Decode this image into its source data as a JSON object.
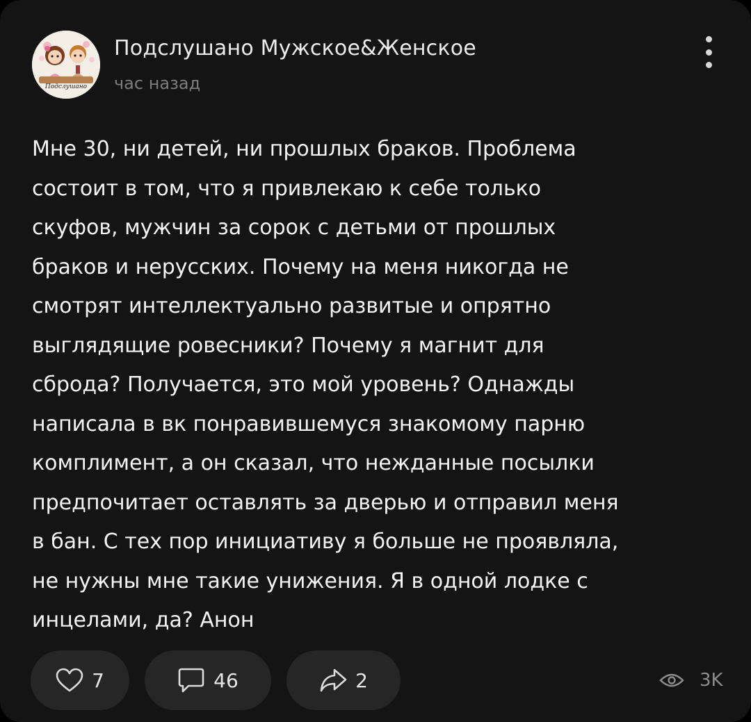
{
  "post": {
    "channel_name": "Подслушано Мужское&Женское",
    "time": "час назад",
    "avatar_caption": "Подслушано",
    "text_lines": [
      "Мне 30, ни детей, ни прошлых браков. Проблема",
      "состоит в том, что я привлекаю к себе только",
      "скуфов, мужчин за сорок с детьми от прошлых",
      "браков и нерусских. Почему на меня никогда не",
      "смотрят интеллектуально развитые и опрятно",
      "выглядящие ровесники? Почему я магнит для",
      "сброда? Получается, это мой уровень? Однажды",
      "написала в вк понравившемуся знакомому парню",
      "комплимент, а он сказал, что нежданные посылки",
      "предпочитает оставлять за дверью и отправил меня",
      "в бан. С тех пор инициативу я больше не проявляла,",
      "не нужны мне такие унижения. Я в одной лодке с",
      "инцелами, да? Анон"
    ]
  },
  "actions": {
    "likes": "7",
    "comments": "46",
    "shares": "2",
    "views": "3K"
  },
  "icons": {
    "like": "heart-icon",
    "comment": "comment-icon",
    "share": "share-icon",
    "views": "eye-icon",
    "menu": "more-vertical-icon"
  },
  "colors": {
    "background": "#141414",
    "pill": "#262626",
    "text": "#f4f4f4",
    "muted": "#7d7d7d"
  }
}
